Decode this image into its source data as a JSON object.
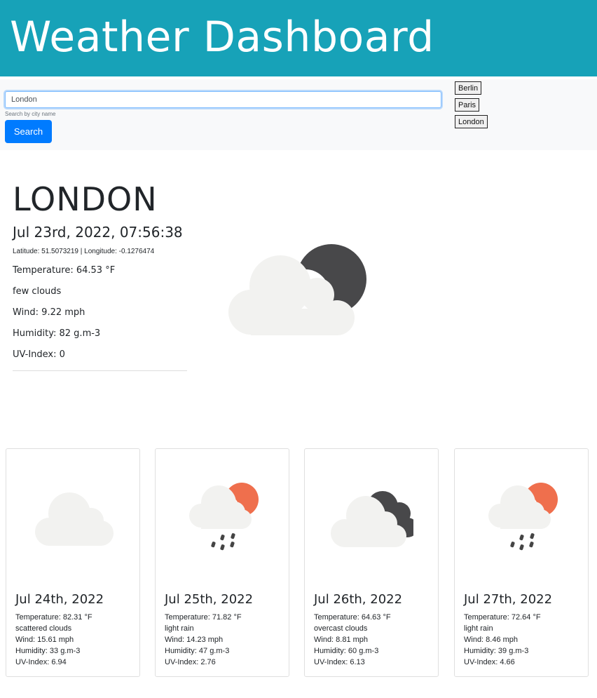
{
  "app": {
    "title": "Weather Dashboard"
  },
  "search": {
    "value": "London",
    "help": "Search by city name",
    "button_label": "Search"
  },
  "history": [
    "Berlin",
    "Paris",
    "London"
  ],
  "current": {
    "city": "LONDON",
    "datetime": "Jul 23rd, 2022, 07:56:38",
    "latitude": "Latitude: 51.5073219",
    "separator": "|",
    "longitude": "Longitude: -0.1276474",
    "temperature": "Temperature: 64.53 °F",
    "description": "few clouds",
    "wind": "Wind: 9.22 mph",
    "humidity": "Humidity: 82 g.m-3",
    "uv": "UV-Index: 0",
    "icon": "few-clouds-night-icon"
  },
  "forecast": [
    {
      "date": "Jul 24th, 2022",
      "temperature": "Temperature: 82.31 °F",
      "description": "scattered clouds",
      "wind": "Wind: 15.61 mph",
      "humidity": "Humidity: 33 g.m-3",
      "uv": "UV-Index: 6.94",
      "icon": "scattered-clouds-icon"
    },
    {
      "date": "Jul 25th, 2022",
      "temperature": "Temperature: 71.82 °F",
      "description": "light rain",
      "wind": "Wind: 14.23 mph",
      "humidity": "Humidity: 47 g.m-3",
      "uv": "UV-Index: 2.76",
      "icon": "light-rain-sun-icon"
    },
    {
      "date": "Jul 26th, 2022",
      "temperature": "Temperature: 64.63 °F",
      "description": "overcast clouds",
      "wind": "Wind: 8.81 mph",
      "humidity": "Humidity: 60 g.m-3",
      "uv": "UV-Index: 6.13",
      "icon": "overcast-clouds-icon"
    },
    {
      "date": "Jul 27th, 2022",
      "temperature": "Temperature: 72.64 °F",
      "description": "light rain",
      "wind": "Wind: 8.46 mph",
      "humidity": "Humidity: 39 g.m-3",
      "uv": "UV-Index: 4.66",
      "icon": "light-rain-sun-icon"
    }
  ],
  "colors": {
    "header": "#17a2b8",
    "button": "#007bff",
    "cloud": "#f2f2f0",
    "dark_cloud": "#48484a",
    "sun": "#ef6f4d",
    "rain": "#444444"
  }
}
